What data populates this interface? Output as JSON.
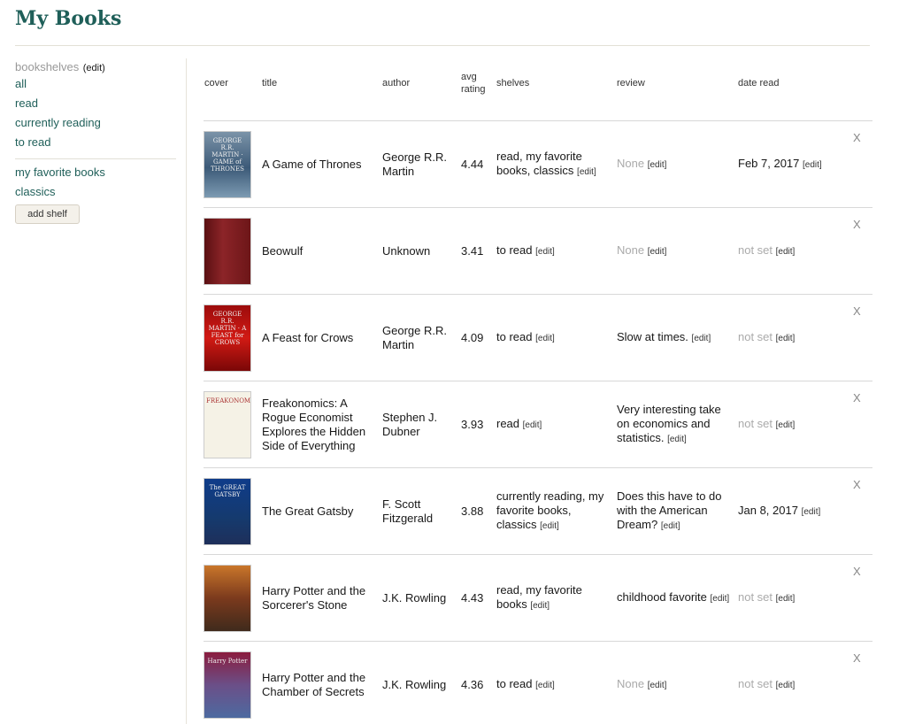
{
  "page": {
    "title": "My Books"
  },
  "sidebar": {
    "bookshelves_label": "bookshelves",
    "edit_label": "(edit)",
    "shelves": [
      "all",
      "read",
      "currently reading",
      "to read"
    ],
    "custom_shelves": [
      "my favorite books",
      "classics"
    ],
    "add_shelf_label": "add shelf"
  },
  "table": {
    "columns": [
      "cover",
      "title",
      "author",
      "avg rating",
      "shelves",
      "review",
      "date read"
    ],
    "edit_label": "[edit]",
    "remove_label": "X",
    "rows": [
      {
        "cover_icon": "game-of-thrones-cover",
        "cover_text": "GEORGE R.R. MARTIN · GAME of THRONES",
        "title": "A Game of Thrones",
        "author": "George R.R. Martin",
        "avg_rating": "4.44",
        "shelves": "read, my favorite books, classics",
        "review": "None",
        "date_read": "Feb 7, 2017"
      },
      {
        "cover_icon": "beowulf-cover",
        "cover_text": "",
        "title": "Beowulf",
        "author": "Unknown",
        "avg_rating": "3.41",
        "shelves": "to read",
        "review": "None",
        "date_read": "not set"
      },
      {
        "cover_icon": "feast-for-crows-cover",
        "cover_text": "GEORGE R.R. MARTIN · A FEAST for CROWS",
        "title": "A Feast for Crows",
        "author": "George R.R. Martin",
        "avg_rating": "4.09",
        "shelves": "to read",
        "review": "Slow at times.",
        "date_read": "not set"
      },
      {
        "cover_icon": "freakonomics-cover",
        "cover_text": "FREAKONOMICS",
        "title": "Freakonomics: A Rogue Economist Explores the Hidden Side of Everything",
        "author": "Stephen J. Dubner",
        "avg_rating": "3.93",
        "shelves": "read",
        "review": "Very interesting take on economics and statistics.",
        "date_read": "not set"
      },
      {
        "cover_icon": "great-gatsby-cover",
        "cover_text": "The GREAT GATSBY",
        "title": "The Great Gatsby",
        "author": "F. Scott Fitzgerald",
        "avg_rating": "3.88",
        "shelves": "currently reading, my favorite books, classics",
        "review": "Does this have to do with the American Dream?",
        "date_read": "Jan 8, 2017"
      },
      {
        "cover_icon": "harry-potter-sorcerers-stone-cover",
        "cover_text": "",
        "title": "Harry Potter and the Sorcerer's Stone",
        "author": "J.K. Rowling",
        "avg_rating": "4.43",
        "shelves": "read, my favorite books",
        "review": "childhood favorite",
        "date_read": "not set"
      },
      {
        "cover_icon": "harry-potter-chamber-of-secrets-cover",
        "cover_text": "Harry Potter",
        "title": "Harry Potter and the Chamber of Secrets",
        "author": "J.K. Rowling",
        "avg_rating": "4.36",
        "shelves": "to read",
        "review": "None",
        "date_read": "not set"
      }
    ]
  }
}
